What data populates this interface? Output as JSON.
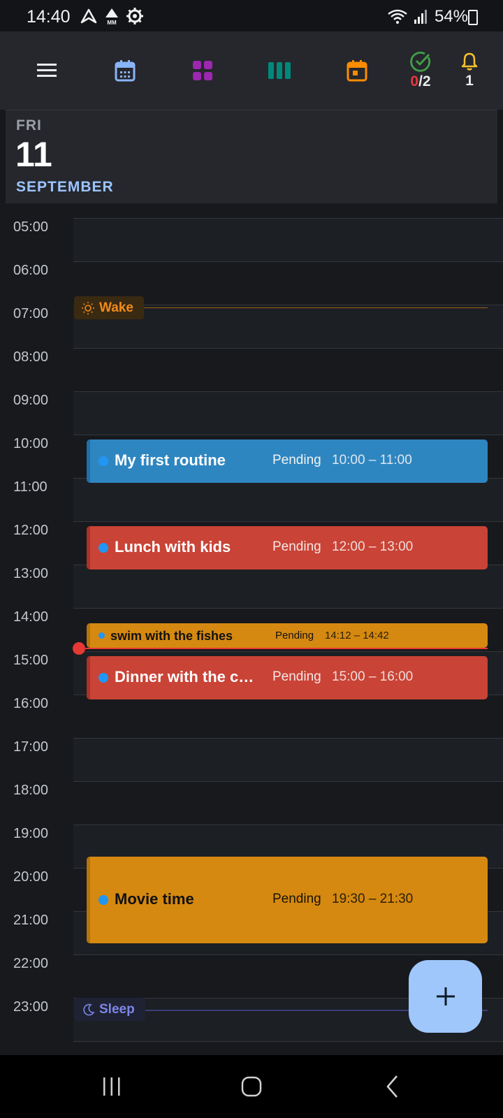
{
  "status_bar": {
    "time": "14:40",
    "battery": "54%",
    "left_icons": [
      "navigation-arrow-icon",
      "mm-alert-icon",
      "settings-gear-icon"
    ],
    "right_icons": [
      "wifi-icon",
      "signal-icon",
      "battery-charging-icon"
    ]
  },
  "toolbar": {
    "icons": [
      "menu-icon",
      "calendar-day-icon",
      "grid-apps-icon",
      "columns-view-icon",
      "event-icon"
    ],
    "tasks": {
      "done": "0",
      "separator": "/",
      "total": "2"
    },
    "alerts": {
      "count": "1"
    },
    "colors": {
      "calendar": "#8ab4f8",
      "grid": "#9c27b0",
      "columns": "#00897b",
      "event": "#fb8c00",
      "tasks": "#43a047",
      "alerts": "#fbc02d"
    }
  },
  "date_header": {
    "day_of_week": "FRI",
    "day": "11",
    "month": "SEPTEMBER"
  },
  "timeline": {
    "hours": [
      "05:00",
      "06:00",
      "07:00",
      "08:00",
      "09:00",
      "10:00",
      "11:00",
      "12:00",
      "13:00",
      "14:00",
      "15:00",
      "16:00",
      "17:00",
      "18:00",
      "19:00",
      "20:00",
      "21:00",
      "22:00",
      "23:00"
    ],
    "wake": {
      "label": "Wake",
      "icon": "sun-icon",
      "color": "#f08a1a"
    },
    "sleep": {
      "label": "Sleep",
      "icon": "moon-icon",
      "color": "#7d86e6"
    },
    "current_time": "14:40"
  },
  "events": [
    {
      "title": "My first routine",
      "status": "Pending",
      "time": "10:00 – 11:00",
      "color": "#2e86c1"
    },
    {
      "title": "Lunch with kids",
      "status": "Pending",
      "time": "12:00 – 13:00",
      "color": "#c94336"
    },
    {
      "title": "swim with the fishes",
      "status": "Pending",
      "time": "14:12 – 14:42",
      "color": "#d68910"
    },
    {
      "title": "Dinner with the c…",
      "status": "Pending",
      "time": "15:00 – 16:00",
      "color": "#c94336"
    },
    {
      "title": "Movie time",
      "status": "Pending",
      "time": "19:30 – 21:30",
      "color": "#d68910"
    }
  ],
  "fab": {
    "icon": "plus-icon"
  },
  "nav_bar": {
    "icons": [
      "recent-apps-icon",
      "home-icon",
      "back-icon"
    ]
  }
}
